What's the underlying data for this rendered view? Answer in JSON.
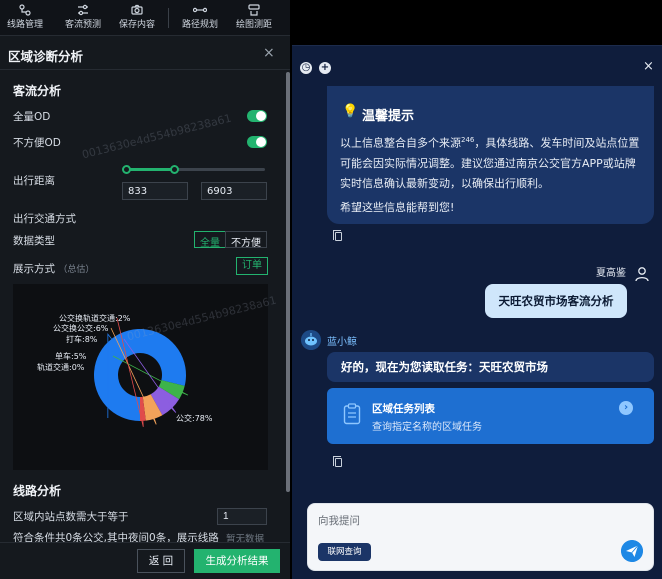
{
  "toolbar": {
    "items": [
      {
        "label": "线路管理",
        "icon": "route-manage-icon"
      },
      {
        "label": "客流预测",
        "icon": "sliders-icon"
      },
      {
        "label": "保存内容",
        "icon": "camera-icon"
      },
      {
        "label": "路径规划",
        "icon": "path-plan-icon"
      },
      {
        "label": "绘图测距",
        "icon": "measure-icon"
      }
    ]
  },
  "panel": {
    "title": "区域诊断分析",
    "close": "×"
  },
  "flow_section": {
    "title": "客流分析",
    "full_od_label": "全量OD",
    "full_od_on": true,
    "inconvenient_od_label": "不方便OD",
    "inconvenient_od_on": true,
    "distance_label": "出行距离",
    "distance_min": "833",
    "distance_max": "6903",
    "mode_label": "出行交通方式",
    "data_type_label": "数据类型",
    "data_type_options": [
      "全量",
      "不方便"
    ],
    "data_type_selected": "全量",
    "display_label": "展示方式",
    "display_hint": "（总估）",
    "order_button": "订单"
  },
  "chart_data": {
    "type": "pie",
    "donut": true,
    "slices": [
      {
        "name": "公交",
        "value": 78,
        "label": "公交:78%",
        "color": "#1e7bf0"
      },
      {
        "name": "轨道交通",
        "value": 0,
        "label": "轨道交通:0%",
        "color": "#1e7bf0"
      },
      {
        "name": "单车",
        "value": 5,
        "label": "单车:5%",
        "color": "#3db34a"
      },
      {
        "name": "打车",
        "value": 8,
        "label": "打车:8%",
        "color": "#8c5ee0"
      },
      {
        "name": "公交换公交",
        "value": 6,
        "label": "公交换公交:6%",
        "color": "#f3a25a"
      },
      {
        "name": "公交换轨道交通",
        "value": 2,
        "label": "公交换轨道交通:2%",
        "color": "#e04b4b"
      }
    ]
  },
  "line_section": {
    "title": "线路分析",
    "min_stops_label": "区域内站点数需大于等于",
    "min_stops_value": "1",
    "result_text": "符合条件共0条公交,其中夜间0条，展示线路",
    "no_data": "暂无数据"
  },
  "footer": {
    "back_label": "返 回",
    "generate_label": "生成分析结果"
  },
  "watermark": "0013630e4d554b98238a61",
  "chat": {
    "header_icons": [
      "history-icon",
      "new-chat-icon"
    ],
    "close": "×",
    "tip": {
      "title": "温馨提示",
      "body_part1": "以上信息整合自多个来源",
      "body_sup": "246",
      "body_part2": "，具体线路、发车时间及站点位置可能会因实际情况调整。建议您通过南京公交官方APP或站牌实时信息确认最新变动，以确保出行顺利。",
      "footer": "希望这些信息能帮到您!"
    },
    "user": {
      "name": "夏高鉴",
      "message": "天旺农贸市场客流分析"
    },
    "bot": {
      "name": "蓝小鲸",
      "message": "好的，现在为您读取任务：天旺农贸市场"
    },
    "task_card": {
      "title": "区域任务列表",
      "description": "查询指定名称的区域任务"
    },
    "input": {
      "placeholder": "向我提问",
      "net_search_label": "联网查询"
    }
  }
}
